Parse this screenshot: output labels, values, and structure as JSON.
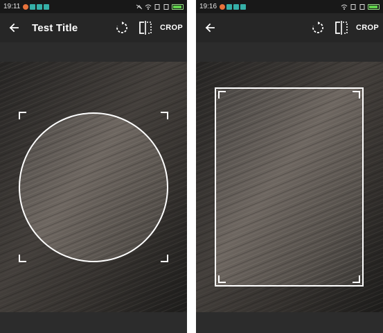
{
  "screens": [
    {
      "status": {
        "time": "19:11"
      },
      "toolbar": {
        "title": "Test Title",
        "crop_label": "CROP"
      },
      "crop_shape": "circle"
    },
    {
      "status": {
        "time": "19:16"
      },
      "toolbar": {
        "title": "",
        "crop_label": "CROP"
      },
      "crop_shape": "rectangle"
    }
  ],
  "icons": {
    "back": "arrow-left-icon",
    "rotate": "rotate-icon",
    "flip": "flip-horizontal-icon"
  },
  "colors": {
    "toolbar_bg": "#262626",
    "status_bg": "#181818",
    "battery": "#5fd34a",
    "crop_frame": "#ffffff"
  }
}
